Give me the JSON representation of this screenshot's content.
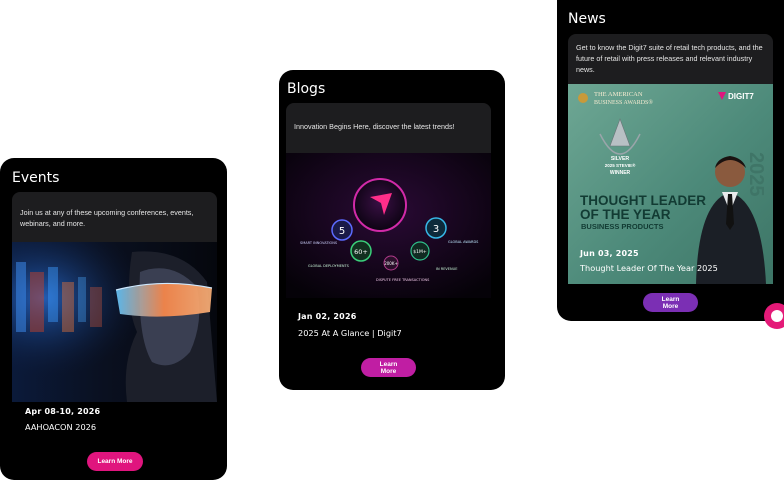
{
  "cards": [
    {
      "title": "Events",
      "description": "Join us at any of these upcoming conferences, events, webinars, and more.",
      "date": "Apr 08-10, 2026",
      "item_title": "AAHOACON 2026",
      "button_label": "Learn More"
    },
    {
      "title": "Blogs",
      "description": "Innovation Begins Here, discover the latest trends!",
      "date": "Jan 02, 2026",
      "item_title": "2025 At A Glance | Digit7",
      "button_label": "Learn More",
      "infographic": {
        "stat_left": "5",
        "stat_right": "3",
        "stat_center": "60+",
        "label_smart": "SMART INNOVATIONS",
        "label_global_awards": "GLOBAL AWARDS",
        "label_global_deploy": "GLOBAL DEPLOYMENTS",
        "label_revenue": "IN REVENUE",
        "label_trans": "DISPUTE FREE TRANSACTIONS",
        "value_200k": "200K+",
        "value_5m": "$1M+"
      }
    },
    {
      "title": "News",
      "description": "Get to know the Digit7 suite of retail tech products, and the future of retail with press releases and relevant industry news.",
      "date": "Jun 03, 2025",
      "item_title": "Thought Leader Of The Year 2025",
      "button_label": "Learn More",
      "award_image": {
        "org_line1": "THE AMERICAN",
        "org_line2": "BUSINESS AWARDS®",
        "brand": "DIGIT7",
        "trophy_line1": "SILVER",
        "trophy_line2": "2025 STEVIE®",
        "trophy_line3": "WINNER",
        "headline_line1": "THOUGHT LEADER",
        "headline_line2": "OF THE YEAR",
        "subhead": "BUSINESS PRODUCTS",
        "year_vertical": "2025"
      }
    }
  ],
  "colors": {
    "events_button": "#e0157e",
    "blogs_button": "#c01ea3",
    "news_button": "#7b2fb4",
    "card_bg": "#000000"
  }
}
